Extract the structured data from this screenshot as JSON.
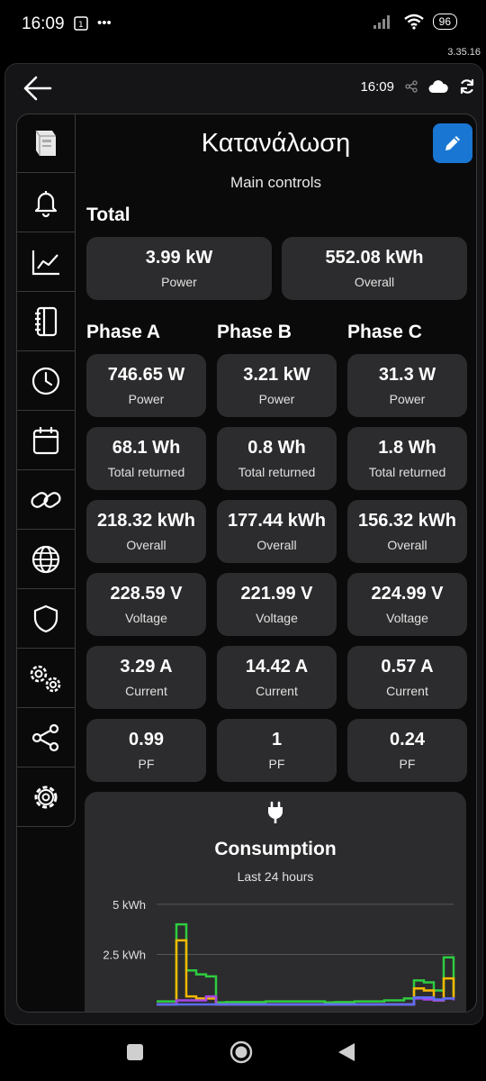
{
  "status": {
    "time": "16:09",
    "battery": "96",
    "version": "3.35.16"
  },
  "topbar": {
    "time": "16:09"
  },
  "sidebar": {
    "items": [
      {
        "icon": "device-icon"
      },
      {
        "icon": "bell-icon"
      },
      {
        "icon": "chart-line-icon"
      },
      {
        "icon": "notebook-icon"
      },
      {
        "icon": "clock-icon"
      },
      {
        "icon": "calendar-icon"
      },
      {
        "icon": "link-icon"
      },
      {
        "icon": "globe-icon"
      },
      {
        "icon": "shield-icon"
      },
      {
        "icon": "gears-icon"
      },
      {
        "icon": "share-icon"
      },
      {
        "icon": "gear-icon"
      }
    ]
  },
  "header": {
    "title": "Κατανάλωση",
    "subtitle": "Main controls"
  },
  "total": {
    "heading": "Total",
    "power": {
      "value": "3.99 kW",
      "label": "Power"
    },
    "overall": {
      "value": "552.08 kWh",
      "label": "Overall"
    }
  },
  "phases": [
    {
      "heading": "Phase A",
      "power": {
        "value": "746.65 W",
        "label": "Power"
      },
      "returned": {
        "value": "68.1 Wh",
        "label": "Total returned"
      },
      "overall": {
        "value": "218.32 kWh",
        "label": "Overall"
      },
      "voltage": {
        "value": "228.59 V",
        "label": "Voltage"
      },
      "current": {
        "value": "3.29 A",
        "label": "Current"
      },
      "pf": {
        "value": "0.99",
        "label": "PF"
      }
    },
    {
      "heading": "Phase B",
      "power": {
        "value": "3.21 kW",
        "label": "Power"
      },
      "returned": {
        "value": "0.8 Wh",
        "label": "Total returned"
      },
      "overall": {
        "value": "177.44 kWh",
        "label": "Overall"
      },
      "voltage": {
        "value": "221.99 V",
        "label": "Voltage"
      },
      "current": {
        "value": "14.42 A",
        "label": "Current"
      },
      "pf": {
        "value": "1",
        "label": "PF"
      }
    },
    {
      "heading": "Phase C",
      "power": {
        "value": "31.3 W",
        "label": "Power"
      },
      "returned": {
        "value": "1.8 Wh",
        "label": "Total returned"
      },
      "overall": {
        "value": "156.32 kWh",
        "label": "Overall"
      },
      "voltage": {
        "value": "224.99 V",
        "label": "Voltage"
      },
      "current": {
        "value": "0.57 A",
        "label": "Current"
      },
      "pf": {
        "value": "0.24",
        "label": "PF"
      }
    }
  ],
  "consumption": {
    "title": "Consumption",
    "subtitle": "Last 24 hours"
  },
  "chart_data": {
    "type": "line",
    "step": true,
    "title": "Consumption",
    "subtitle": "Last 24 hours",
    "y_ticks": [
      {
        "value": 5,
        "label": "5 kWh"
      },
      {
        "value": 2.5,
        "label": "2.5 kWh"
      }
    ],
    "ylim": [
      0,
      5.4
    ],
    "x": [
      0,
      1,
      2,
      3,
      4,
      5,
      6,
      7,
      8,
      9,
      10,
      11,
      12,
      13,
      14,
      15,
      16,
      17,
      18,
      19,
      20,
      21,
      22,
      23,
      24,
      25,
      26,
      27,
      28,
      29,
      30
    ],
    "series": [
      {
        "color": "#2ecc40",
        "values": [
          0.15,
          0.15,
          4.0,
          1.7,
          1.5,
          1.4,
          0.1,
          0.12,
          0.12,
          0.12,
          0.12,
          0.15,
          0.15,
          0.15,
          0.15,
          0.15,
          0.15,
          0.1,
          0.12,
          0.12,
          0.15,
          0.15,
          0.15,
          0.2,
          0.2,
          0.3,
          1.2,
          1.1,
          0.7,
          2.35,
          0.5
        ]
      },
      {
        "color": "#f5b800",
        "values": [
          0,
          0,
          3.2,
          0.4,
          0.3,
          0.3,
          0,
          0,
          0,
          0,
          0,
          0,
          0,
          0,
          0,
          0,
          0,
          0,
          0,
          0,
          0,
          0,
          0,
          0,
          0,
          0,
          0.8,
          0.7,
          0.2,
          1.3,
          0.3
        ]
      },
      {
        "color": "#a845e8",
        "values": [
          0,
          0,
          0.2,
          0.2,
          0.2,
          0.4,
          0,
          0,
          0,
          0,
          0,
          0,
          0,
          0,
          0,
          0,
          0,
          0,
          0,
          0,
          0,
          0,
          0,
          0,
          0,
          0,
          0.3,
          0.25,
          0.2,
          0.3,
          0.2
        ]
      },
      {
        "color": "#5b6ef5",
        "values": [
          0,
          0,
          0,
          0,
          0,
          0,
          0,
          0,
          0,
          0,
          0,
          0,
          0,
          0,
          0,
          0,
          0,
          0,
          0,
          0,
          0,
          0,
          0,
          0,
          0,
          0,
          0.35,
          0.35,
          0.25,
          0.3,
          0.25
        ]
      }
    ]
  }
}
